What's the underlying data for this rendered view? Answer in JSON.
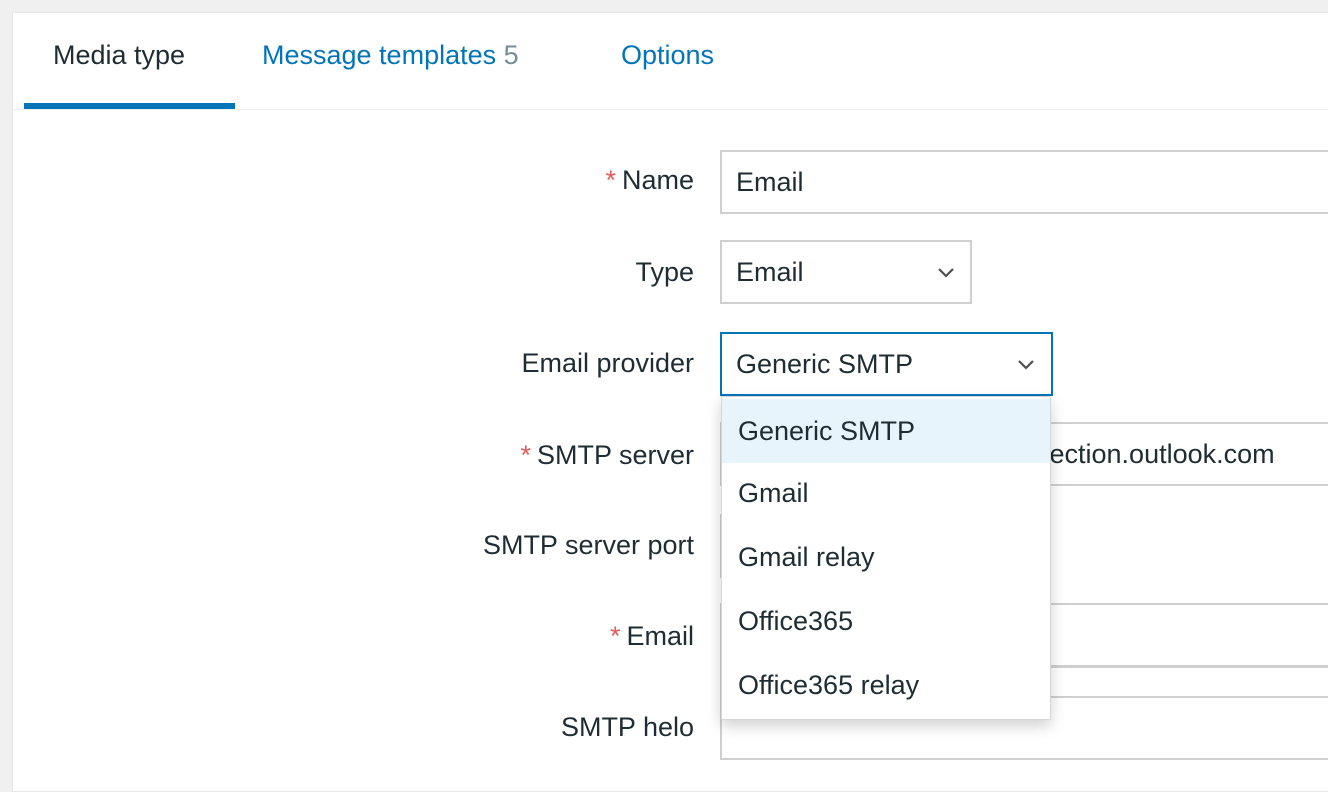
{
  "tabs": [
    {
      "label": "Media type"
    },
    {
      "label": "Message templates",
      "count": "5"
    },
    {
      "label": "Options"
    }
  ],
  "form": {
    "name": {
      "label": "Name",
      "required_mark": "*",
      "value": "Email"
    },
    "type": {
      "label": "Type",
      "value": "Email"
    },
    "email_provider": {
      "label": "Email provider",
      "value": "Generic SMTP"
    },
    "smtp_server": {
      "label": "SMTP server",
      "required_mark": "*",
      "value_visible": "tection.outlook.com"
    },
    "smtp_server_port": {
      "label": "SMTP server port"
    },
    "email": {
      "label": "Email",
      "required_mark": "*"
    },
    "smtp_helo": {
      "label": "SMTP helo"
    }
  },
  "provider_dropdown": {
    "options": [
      "Generic SMTP",
      "Gmail",
      "Gmail relay",
      "Office365",
      "Office365 relay"
    ],
    "highlighted": "Generic SMTP"
  },
  "colors": {
    "accent": "#0275b8",
    "required": "#e45959",
    "text": "#1f2c33",
    "muted": "#768d99",
    "highlight": "#e8f4fb"
  }
}
